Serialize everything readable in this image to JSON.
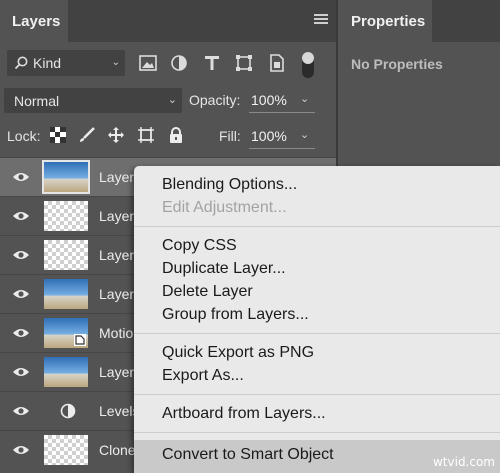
{
  "layers_panel": {
    "tab_label": "Layers",
    "filter": {
      "kind_label": "Kind"
    },
    "blend_mode": "Normal",
    "opacity_label": "Opacity:",
    "opacity_value": "100%",
    "lock_label": "Lock:",
    "fill_label": "Fill:",
    "fill_value": "100%",
    "layers": [
      {
        "name": "Layer",
        "thumb": "sky"
      },
      {
        "name": "Layer",
        "thumb": "check"
      },
      {
        "name": "Layer",
        "thumb": "check"
      },
      {
        "name": "Layer",
        "thumb": "sky"
      },
      {
        "name": "Motio",
        "thumb": "sky"
      },
      {
        "name": "Layer",
        "thumb": "sky"
      },
      {
        "name": "Levels",
        "thumb": "adjustment"
      },
      {
        "name": "Clone",
        "thumb": "check"
      }
    ]
  },
  "properties_panel": {
    "tab_label": "Properties",
    "empty_text": "No Properties"
  },
  "context_menu": {
    "items": [
      {
        "label": "Blending Options...",
        "enabled": true
      },
      {
        "label": "Edit Adjustment...",
        "enabled": false
      },
      {
        "label": "Copy CSS",
        "enabled": true
      },
      {
        "label": "Duplicate Layer...",
        "enabled": true
      },
      {
        "label": "Delete Layer",
        "enabled": true
      },
      {
        "label": "Group from Layers...",
        "enabled": true
      },
      {
        "label": "Quick Export as PNG",
        "enabled": true
      },
      {
        "label": "Export As...",
        "enabled": true
      },
      {
        "label": "Artboard from Layers...",
        "enabled": true
      },
      {
        "label": "Convert to Smart Object",
        "enabled": true,
        "highlighted": true
      }
    ]
  },
  "watermark": "wtvid.com",
  "colors": {
    "panel": "#535353",
    "tabbar": "#424242",
    "menu": "#e9e9e9",
    "menu_highlight": "#c9c9c9"
  }
}
